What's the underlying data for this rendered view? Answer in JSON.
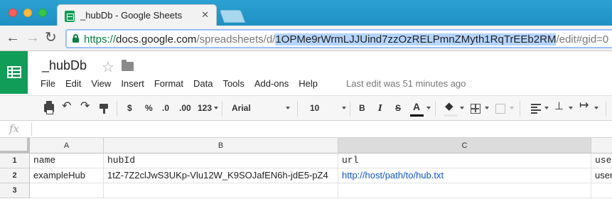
{
  "browser": {
    "tab_title": "_hubDb - Google Sheets",
    "tab_close": "✕",
    "nav": {
      "back": "←",
      "forward": "→",
      "reload": "↻"
    },
    "url": {
      "scheme": "https://",
      "host": "docs.google.com",
      "path": "/spreadsheets/d/",
      "id": "1OPMe9rWrmLJJUind7zzOzRELPmnZMyth1RqTrEEb2RM",
      "suffix": "/edit#gid=0"
    }
  },
  "doc": {
    "title": "_hubDb",
    "star": "☆",
    "last_edit": "Last edit was 51 minutes ago",
    "menu": [
      "File",
      "Edit",
      "View",
      "Insert",
      "Format",
      "Data",
      "Tools",
      "Add-ons",
      "Help"
    ]
  },
  "format_toolbar": {
    "undo": "↶",
    "redo": "↷",
    "currency": "$",
    "percent": "%",
    "dec_less": ".0",
    "dec_more": ".00",
    "more_formats": "123",
    "font": "Arial",
    "size": "10",
    "bold": "B",
    "italic": "I",
    "strike": "S",
    "text_color": "A",
    "valign": "⊥",
    "wrap": "↦"
  },
  "formula_bar": {
    "fx": "fx",
    "value": ""
  },
  "sheet": {
    "columns": [
      "A",
      "B",
      "C",
      ""
    ],
    "rows": [
      {
        "num": "1",
        "cells": [
          "name",
          "hubId",
          "url",
          "user"
        ]
      },
      {
        "num": "2",
        "cells": [
          "exampleHub",
          "1tZ-7Z2clJwS3UKp-Vlu12W_K9SOJafEN6h-jdE5-pZ4",
          "http://host/path/to/hub.txt",
          "user"
        ]
      },
      {
        "num": "3",
        "cells": [
          "",
          "",
          "",
          ""
        ]
      }
    ]
  },
  "colors": {
    "sheets_green": "#0f9d58",
    "chrome_blue": "#2ba1d2",
    "link_blue": "#1155cc",
    "url_highlight": "#b4d5fe"
  }
}
